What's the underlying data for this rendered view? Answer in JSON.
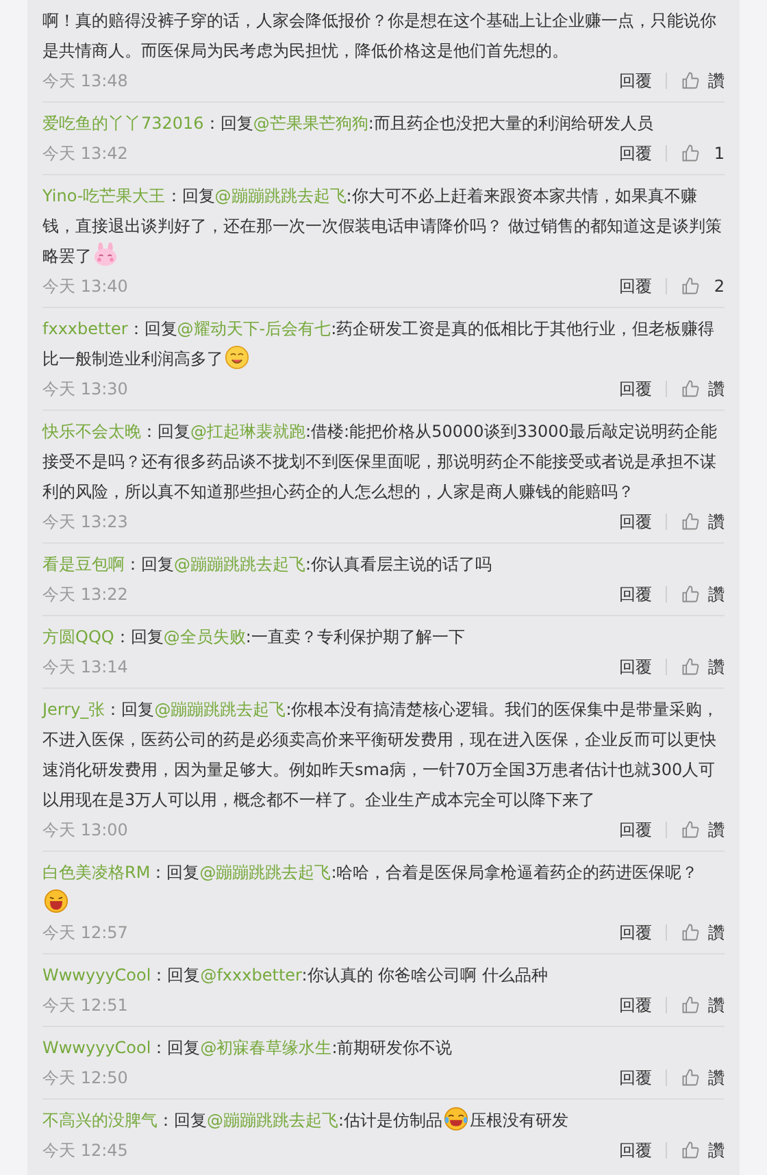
{
  "comments": [
    {
      "parts": [
        {
          "kind": "text",
          "text": "啊！真的赔得没裤子穿的话，人家会降低报价？你是想在这个基础上让企业赚一点，只能说你是共情商人。而医保局为民考虑为民担忧，降低价格这是他们首先想的。"
        }
      ],
      "time": "今天 13:48",
      "reply": "回覆",
      "likes": "讚"
    },
    {
      "user": "爱吃鱼的丫丫732016",
      "prefix": "：回复",
      "mention": "@芒果果芒狗狗",
      "parts": [
        {
          "kind": "text",
          "text": ":而且药企也没把大量的利润给研发人员"
        }
      ],
      "time": "今天 13:42",
      "reply": "回覆",
      "likes": "1"
    },
    {
      "user": "Yino-吃芒果大王",
      "prefix": "：回复",
      "mention": "@蹦蹦跳跳去起飞",
      "parts": [
        {
          "kind": "text",
          "text": ":你大可不必上赶着来跟资本家共情，如果真不赚钱，直接退出谈判好了，还在那一次一次假装电话申请降价吗？ 做过销售的都知道这是谈判策略罢了"
        },
        {
          "kind": "bunny"
        }
      ],
      "time": "今天 13:40",
      "reply": "回覆",
      "likes": "2"
    },
    {
      "user": "fxxxbetter",
      "prefix": "：回复",
      "mention": "@耀动天下-后会有七",
      "parts": [
        {
          "kind": "text",
          "text": ":药企研发工资是真的低相比于其他行业，但老板赚得比一般制造业利润高多了"
        },
        {
          "kind": "yum"
        }
      ],
      "time": "今天 13:30",
      "reply": "回覆",
      "likes": "讚"
    },
    {
      "user": "快乐不会太晚",
      "prefix": "：回复",
      "mention": "@扛起琳裴就跑",
      "parts": [
        {
          "kind": "text",
          "text": ":借楼:能把价格从50000谈到33000最后敲定说明药企能接受不是吗？还有很多药品谈不拢划不到医保里面呢，那说明药企不能接受或者说是承担不谋利的风险，所以真不知道那些担心药企的人怎么想的，人家是商人赚钱的能赔吗？"
        }
      ],
      "time": "今天 13:23",
      "reply": "回覆",
      "likes": "讚"
    },
    {
      "user": "看是豆包啊",
      "prefix": "：回复",
      "mention": "@蹦蹦跳跳去起飞",
      "parts": [
        {
          "kind": "text",
          "text": ":你认真看层主说的话了吗"
        }
      ],
      "time": "今天 13:22",
      "reply": "回覆",
      "likes": "讚"
    },
    {
      "user": "方圆QQQ",
      "prefix": "：回复",
      "mention": "@全员失败",
      "parts": [
        {
          "kind": "text",
          "text": ":一直卖？专利保护期了解一下"
        }
      ],
      "time": "今天 13:14",
      "reply": "回覆",
      "likes": "讚"
    },
    {
      "user": "Jerry_张",
      "prefix": "：回复",
      "mention": "@蹦蹦跳跳去起飞",
      "parts": [
        {
          "kind": "text",
          "text": ":你根本没有搞清楚核心逻辑。我们的医保集中是带量采购，不进入医保，医药公司的药是必须卖高价来平衡研发费用，现在进入医保，企业反而可以更快速消化研发费用，因为量足够大。例如昨天sma病，一针70万全国3万患者估计也就300人可以用现在是3万人可以用，概念都不一样了。企业生产成本完全可以降下来了"
        }
      ],
      "time": "今天 13:00",
      "reply": "回覆",
      "likes": "讚"
    },
    {
      "user": "白色美凌格RM",
      "prefix": "：回复",
      "mention": "@蹦蹦跳跳去起飞",
      "parts": [
        {
          "kind": "text",
          "text": ":哈哈，合着是医保局拿枪逼着药企的药进医保呢？"
        },
        {
          "kind": "break"
        },
        {
          "kind": "laugh"
        }
      ],
      "time": "今天 12:57",
      "reply": "回覆",
      "likes": "讚"
    },
    {
      "user": "WwwyyyCool",
      "prefix": "：回复",
      "mention": "@fxxxbetter",
      "parts": [
        {
          "kind": "text",
          "text": ":你认真的 你爸啥公司啊 什么品种"
        }
      ],
      "time": "今天 12:51",
      "reply": "回覆",
      "likes": "讚"
    },
    {
      "user": "WwwyyyCool",
      "prefix": "：回复",
      "mention": "@初寐春草缘水生",
      "parts": [
        {
          "kind": "text",
          "text": ":前期研发你不说"
        }
      ],
      "time": "今天 12:50",
      "reply": "回覆",
      "likes": "讚"
    },
    {
      "user": "不高兴的没脾气",
      "prefix": "：回复",
      "mention": "@蹦蹦跳跳去起飞",
      "parts": [
        {
          "kind": "text",
          "text": ":估计是仿制品"
        },
        {
          "kind": "tears"
        },
        {
          "kind": "text",
          "text": "压根没有研发"
        }
      ],
      "time": "今天 12:45",
      "reply": "回覆",
      "likes": "讚"
    }
  ]
}
